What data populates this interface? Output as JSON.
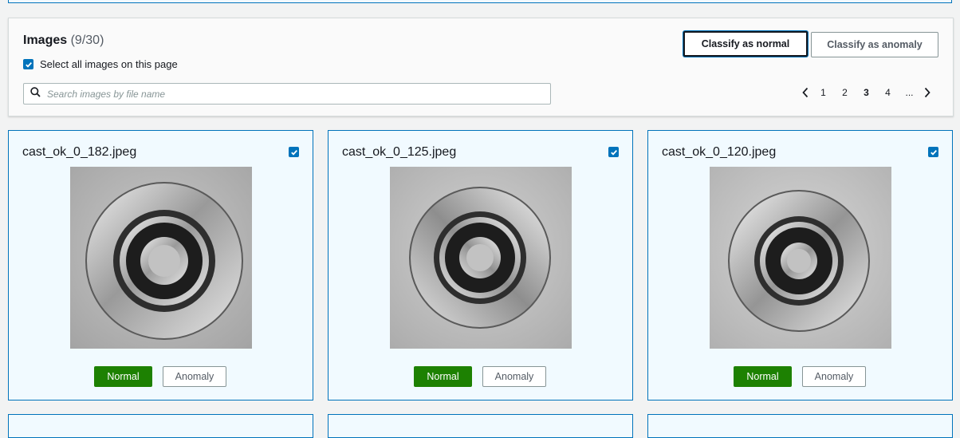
{
  "header": {
    "title": "Images",
    "count": "(9/30)",
    "select_all_label": "Select all images on this page",
    "select_all_checked": true,
    "search_placeholder": "Search images by file name",
    "search_value": "",
    "classify_normal_label": "Classify as normal",
    "classify_anomaly_label": "Classify as anomaly"
  },
  "pagination": {
    "pages": [
      "1",
      "2",
      "3",
      "4",
      "..."
    ],
    "current": "3"
  },
  "images": [
    {
      "file_name": "cast_ok_0_182.jpeg",
      "checked": true,
      "normal_label": "Normal",
      "anomaly_label": "Anomaly",
      "selected_label": "Normal"
    },
    {
      "file_name": "cast_ok_0_125.jpeg",
      "checked": true,
      "normal_label": "Normal",
      "anomaly_label": "Anomaly",
      "selected_label": "Normal"
    },
    {
      "file_name": "cast_ok_0_120.jpeg",
      "checked": true,
      "normal_label": "Normal",
      "anomaly_label": "Anomaly",
      "selected_label": "Normal"
    }
  ],
  "colors": {
    "accent": "#0073bb",
    "normal_selected": "#1d8102",
    "card_background": "#f1faff"
  },
  "icons": [
    "checkbox-checked-icon",
    "search-icon",
    "chevron-left-icon",
    "chevron-right-icon"
  ]
}
